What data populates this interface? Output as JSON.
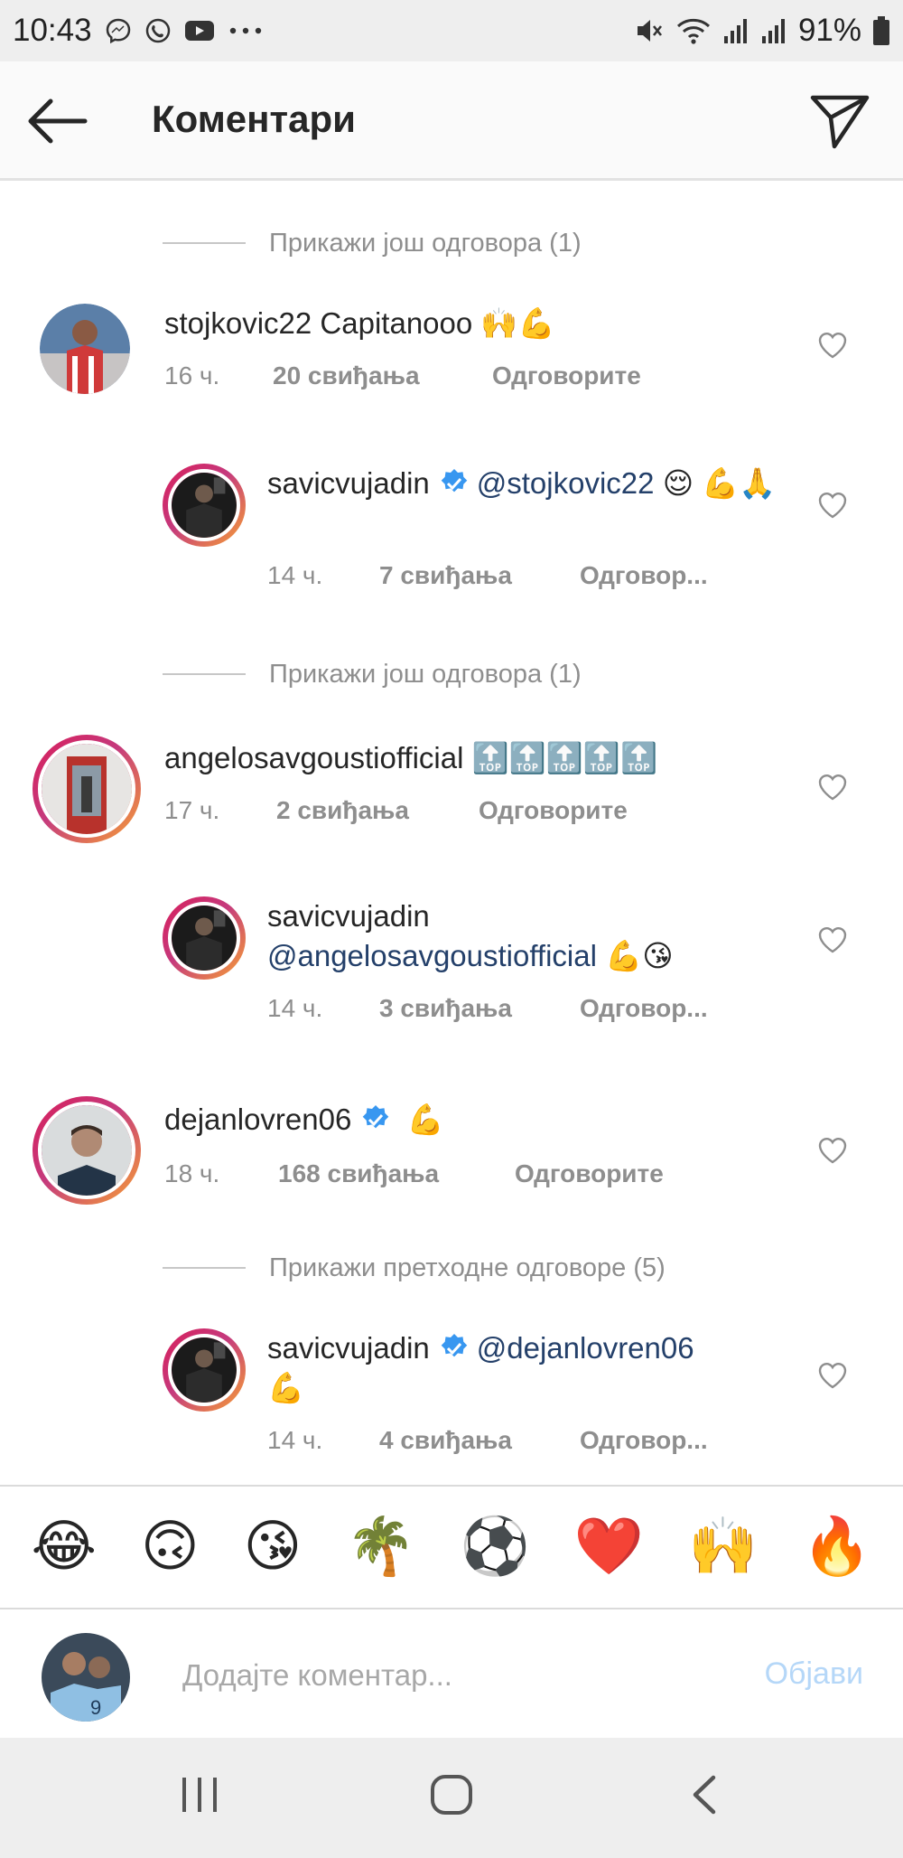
{
  "status_bar": {
    "time": "10:43",
    "battery": "91%",
    "icons": [
      "messenger-icon",
      "viber-icon",
      "youtube-icon",
      "more-icon",
      "mute-icon",
      "wifi-icon",
      "signal-icon",
      "signal-icon",
      "battery-icon"
    ]
  },
  "header": {
    "title": "Коментари",
    "back_icon": "back-arrow-icon",
    "share_icon": "send-icon"
  },
  "more_replies": [
    {
      "label": "Прикажи још одговора (1)"
    },
    {
      "label": "Прикажи још одговора (1)"
    },
    {
      "label": "Прикажи претходне одговоре (5)"
    }
  ],
  "comments": [
    {
      "username": "stojkovic22",
      "text": "Capitanooo 🙌💪",
      "time": "16 ч.",
      "likes": "20 свиђања",
      "reply": "Одговорите"
    },
    {
      "username": "savicvujadin",
      "mention": "@stojkovic22",
      "text": "😌 💪🙏",
      "time": "14 ч.",
      "likes": "7 свиђања",
      "reply": "Одговор..."
    },
    {
      "username": "angelosavgoustiofficial",
      "text": "🔝🔝🔝🔝🔝",
      "time": "17 ч.",
      "likes": "2 свиђања",
      "reply": "Одговорите"
    },
    {
      "username": "savicvujadin",
      "mention": "@angelosavgoustiofficial",
      "text": "💪😘",
      "time": "14 ч.",
      "likes": "3 свиђања",
      "reply": "Одговор..."
    },
    {
      "username": "dejanlovren06",
      "text": "💪",
      "time": "18 ч.",
      "likes": "168 свиђања",
      "reply": "Одговорите"
    },
    {
      "username": "savicvujadin",
      "mention": "@dejanlovren06",
      "text": "💪",
      "time": "14 ч.",
      "likes": "4 свиђања",
      "reply": "Одговор..."
    }
  ],
  "emoji_bar": [
    "😂",
    "🙃",
    "😘",
    "🌴",
    "⚽",
    "❤️",
    "🙌",
    "🔥"
  ],
  "compose": {
    "placeholder": "Додајте коментар...",
    "post_label": "Објави"
  },
  "colors": {
    "mention": "#24406a",
    "verified": "#3897f0",
    "muted": "#8e8e8e",
    "post_disabled": "#b5d7f8"
  }
}
